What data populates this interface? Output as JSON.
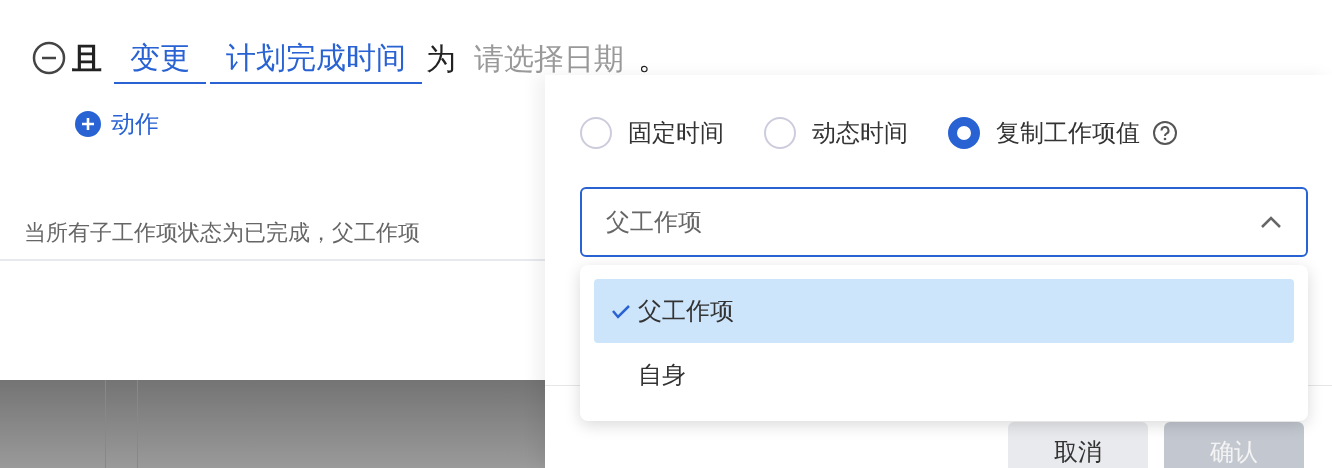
{
  "rule": {
    "prefix": "且",
    "action": "变更",
    "field": "计划完成时间",
    "connector": "为",
    "value_placeholder": "请选择日期",
    "end": "。"
  },
  "add_action": {
    "label": "动作"
  },
  "hint": "当所有子工作项状态为已完成，父工作项",
  "popover": {
    "modes": [
      {
        "label": "固定时间",
        "selected": false
      },
      {
        "label": "动态时间",
        "selected": false
      },
      {
        "label": "复制工作项值",
        "selected": true,
        "help": true
      }
    ],
    "select": {
      "value": "父工作项",
      "expanded": true
    },
    "options": [
      {
        "label": "父工作项",
        "selected": true
      },
      {
        "label": "自身",
        "selected": false
      }
    ],
    "buttons": [
      {
        "label": "取消",
        "kind": "secondary",
        "disabled": false
      },
      {
        "label": "确认",
        "kind": "primary",
        "disabled": true
      }
    ]
  }
}
